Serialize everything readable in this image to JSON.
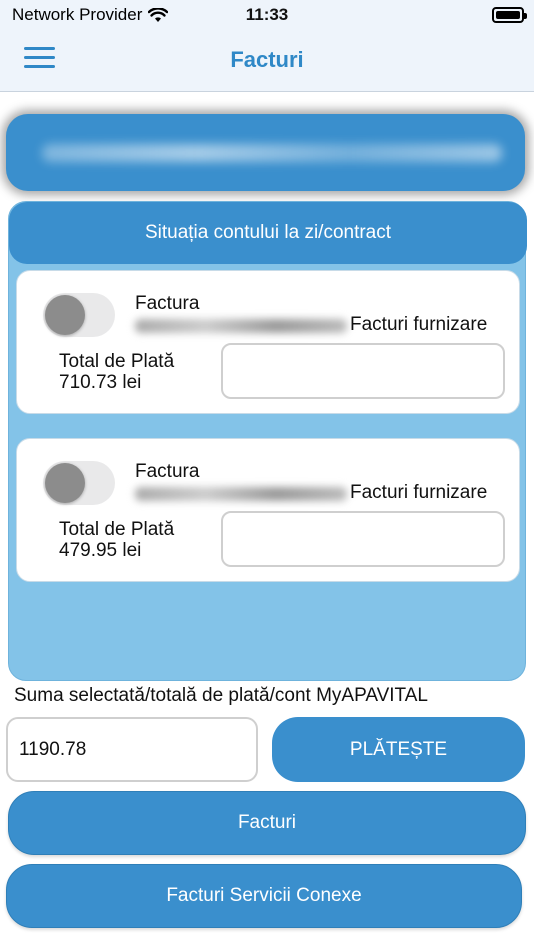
{
  "status_bar": {
    "carrier": "Network Provider",
    "time": "11:33"
  },
  "nav": {
    "title": "Facturi"
  },
  "panel": {
    "header": "Situația contului la zi/contract"
  },
  "invoices": [
    {
      "title": "Factura",
      "type": "Facturi furnizare",
      "total_label": "Total de Plată",
      "total_value": "710.73 lei",
      "selected": false
    },
    {
      "title": "Factura",
      "type": "Facturi furnizare",
      "total_label": "Total de Plată",
      "total_value": "479.95 lei",
      "selected": false
    }
  ],
  "summary": {
    "label": "Suma selectată/totală de plată/cont MyAPAVITAL",
    "value": "1190.78",
    "pay_label": "PLĂTEȘTE"
  },
  "buttons": {
    "invoices": "Facturi",
    "related_services": "Facturi Servicii Conexe"
  },
  "colors": {
    "accent": "#3a8fcd",
    "panel_bg": "#83c3e8",
    "nav_title": "#2f88c7"
  }
}
